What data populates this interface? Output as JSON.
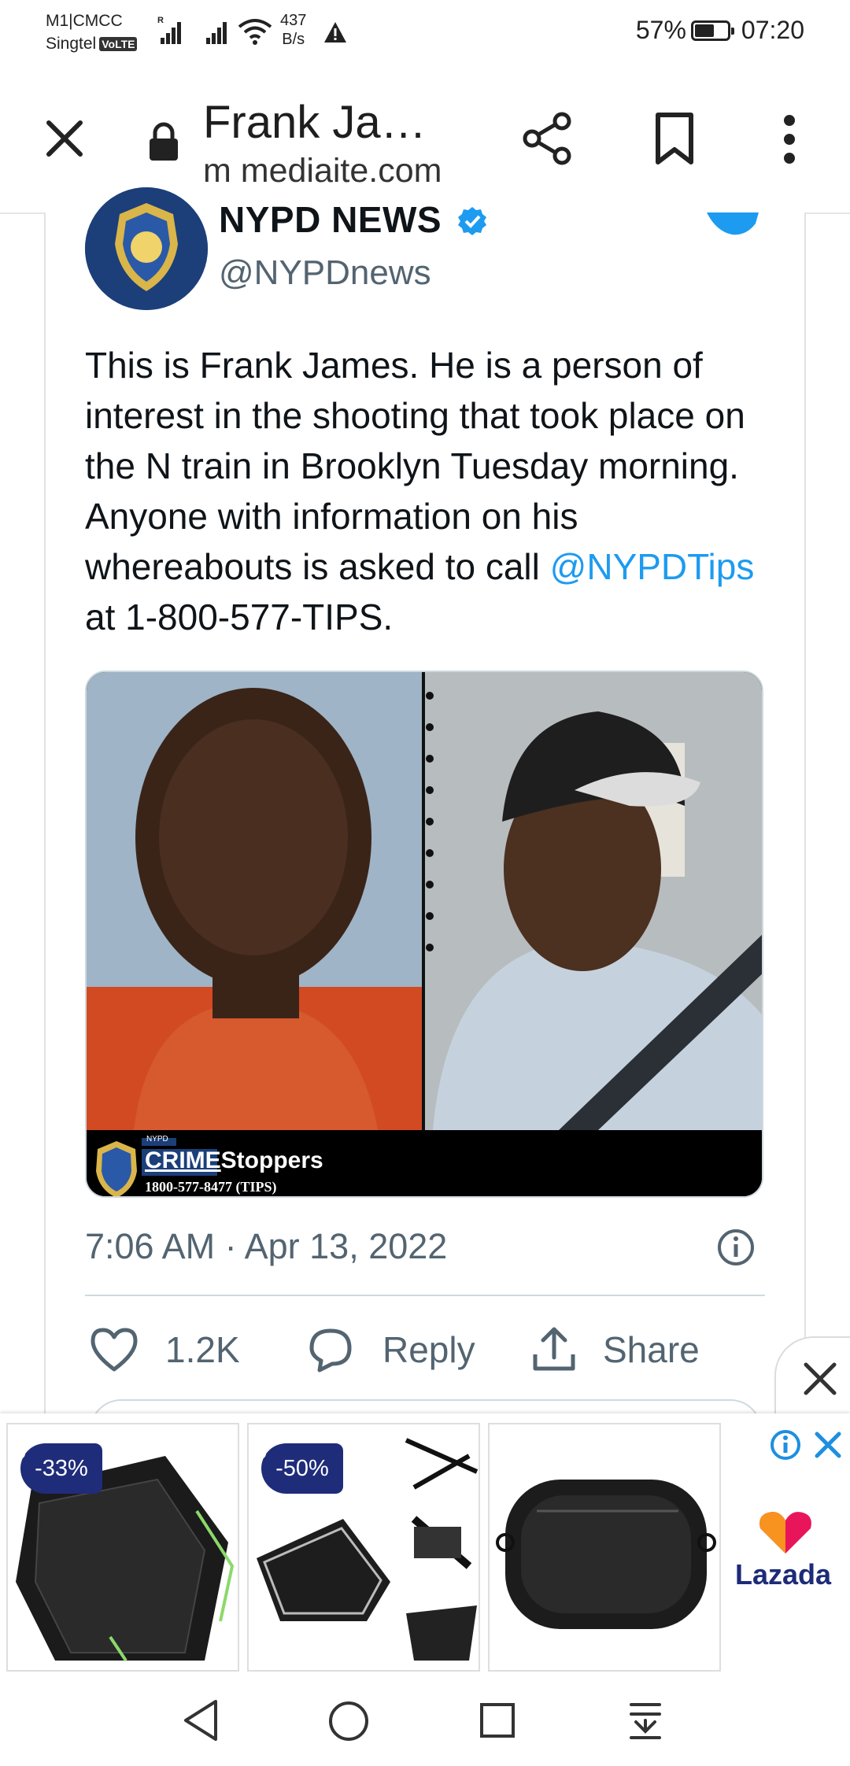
{
  "status_bar": {
    "carrier_line1": "M1|CMCC",
    "carrier_line2": "Singtel",
    "volte": "VoLTE",
    "roaming": "R",
    "speed_value": "437",
    "speed_unit": "B/s",
    "battery": "57%",
    "time": "07:20"
  },
  "toolbar": {
    "title": "Frank Ja…",
    "url": "m mediaite.com"
  },
  "tweet": {
    "name": "NYPD NEWS",
    "handle": "@NYPDnews",
    "text_before": "This is Frank James. He is a person of interest in the shooting that took place on the N train in Brooklyn Tuesday morning. Anyone with information on his whereabouts is asked to call ",
    "mention": "@NYPDTips",
    "text_after": " at 1-800-577-TIPS.",
    "timestamp": "7:06 AM · Apr 13, 2022",
    "likes": "1.2K",
    "reply_label": "Reply",
    "share_label": "Share",
    "media_banner": {
      "small_label": "NYPD",
      "crime": "CRIME",
      "stoppers": "Stoppers",
      "phone": "1800-577-8477 (TIPS)"
    }
  },
  "ad": {
    "items": [
      {
        "discount": "-33%"
      },
      {
        "discount": "-50%"
      },
      {
        "discount": ""
      }
    ],
    "brand": "Lazada",
    "brand_colors": [
      "#f7931e",
      "#e9155a",
      "#1d2b78"
    ]
  },
  "colors": {
    "link": "#1d9bf0",
    "verified": "#1d9bf0",
    "secondary_text": "#536471",
    "discount_tag": "#1f2c7a"
  },
  "icons": [
    "close-icon",
    "lock-icon",
    "share-icon",
    "bookmark-icon",
    "more-icon",
    "verified-icon",
    "twitter-bird-icon",
    "heart-icon",
    "reply-icon",
    "share-upload-icon",
    "info-icon",
    "ad-info-icon",
    "ad-close-icon",
    "back-icon",
    "home-icon",
    "recents-icon",
    "notification-down-icon"
  ]
}
